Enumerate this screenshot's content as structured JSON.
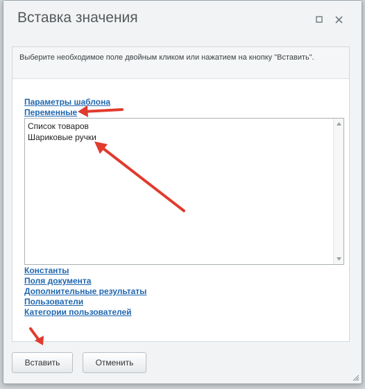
{
  "dialog": {
    "title": "Вставка значения",
    "hint": "Выберите необходимое поле двойным кликом или нажатием на кнопку \"Вставить\"."
  },
  "links": {
    "template_params": "Параметры шаблона",
    "variables": "Переменные",
    "constants": "Константы",
    "document_fields": "Поля документа",
    "additional_results": "Дополнительные результаты",
    "users": "Пользователи",
    "user_categories": "Категории пользователей"
  },
  "listbox": {
    "items": [
      "Список товаров",
      "Шариковые ручки"
    ]
  },
  "buttons": {
    "insert": "Вставить",
    "cancel": "Отменить"
  },
  "icons": {
    "maximize": "maximize-icon",
    "close": "close-icon",
    "scroll_up": "scroll-up-icon",
    "scroll_down": "scroll-down-icon",
    "resize": "resize-grip-icon"
  },
  "colors": {
    "link": "#2067b0",
    "annotation_arrow": "#e03b2e",
    "dialog_bg": "#f1f3f4"
  }
}
